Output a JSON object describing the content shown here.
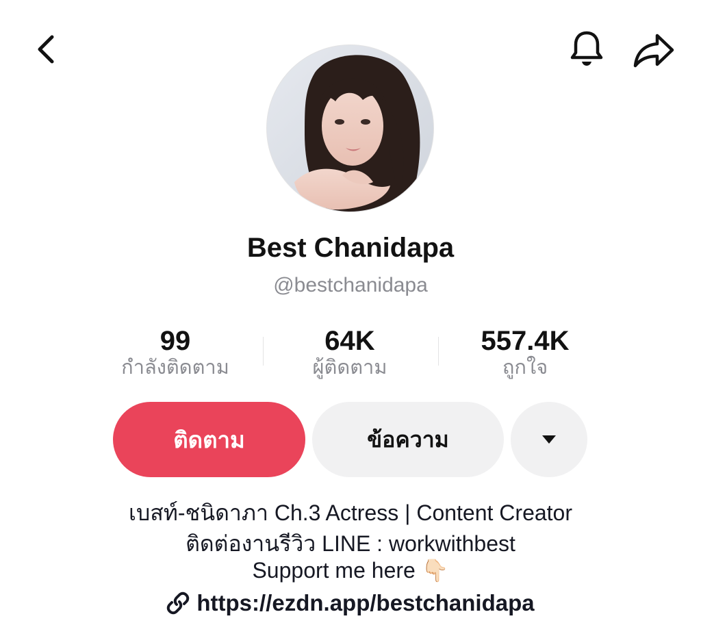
{
  "header": {
    "back_icon": "chevron-left-icon",
    "bell_icon": "bell-icon",
    "share_icon": "share-arrow-icon"
  },
  "profile": {
    "avatar": "profile-photo",
    "display_name": "Best Chanidapa",
    "handle": "@bestchanidapa"
  },
  "stats": [
    {
      "value": "99",
      "label": "กำลังติดตาม"
    },
    {
      "value": "64K",
      "label": "ผู้ติดตาม"
    },
    {
      "value": "557.4K",
      "label": "ถูกใจ"
    }
  ],
  "actions": {
    "follow_label": "ติดตาม",
    "message_label": "ข้อความ",
    "more_icon": "caret-down-icon"
  },
  "bio": {
    "line1": "เบสท์-ชนิดาภา Ch.3 Actress | Content Creator",
    "line2": "ติดต่องานรีวิว LINE : workwithbest",
    "line3_text": "Support me here",
    "line3_emoji": "👇🏻",
    "link_icon": "link-icon",
    "link_url": "https://ezdn.app/bestchanidapa"
  },
  "colors": {
    "accent": "#ea445a",
    "secondary_button": "#f1f1f2",
    "muted_text": "#8a8b91"
  }
}
